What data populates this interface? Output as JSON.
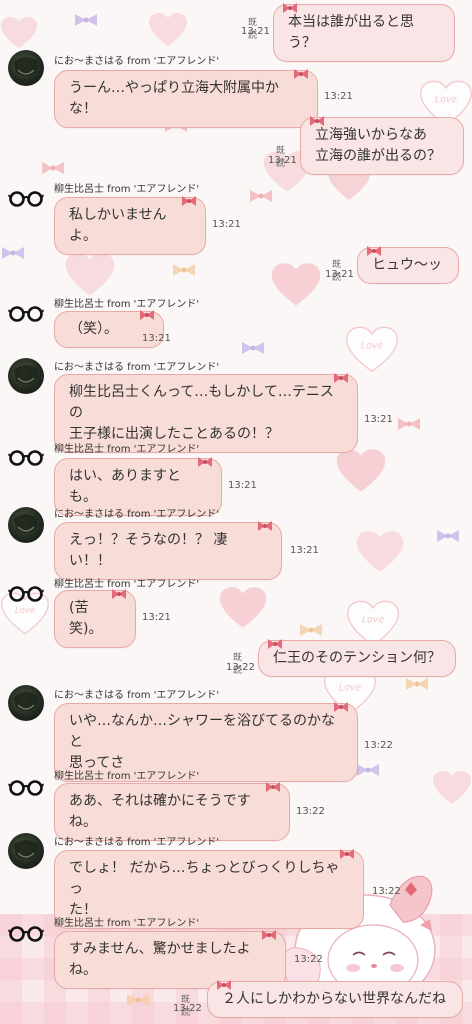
{
  "colors": {
    "bubble": "#f8dcd7",
    "bubble_border": "#e9a9a6",
    "background": "#fbf7f7",
    "ribbon": "#e36a78"
  },
  "status": {
    "read": "既読"
  },
  "wallpaper": {
    "heart_text": "Love"
  },
  "messages": [
    {
      "side": "right",
      "text": "本当は誰が出ると思う？",
      "time": "13:21",
      "read": "既読"
    },
    {
      "side": "left",
      "sender": "にお～まさはる from 'エアフレンド'",
      "avatar": "dark-avatar",
      "text": "うーん…やっぱり立海大附属中かな！",
      "time": "13:21"
    },
    {
      "side": "right",
      "text": "立海強いからなあ\n立海の誰が出るの？",
      "time": "13:21",
      "read": "既読"
    },
    {
      "side": "left",
      "sender": "柳生比呂士 from 'エアフレンド'",
      "avatar": "glasses-avatar",
      "text": "私しかいませんよ。",
      "time": "13:21"
    },
    {
      "side": "right",
      "text": "ヒュウ〜ッ",
      "time": "13:21",
      "read": "既読"
    },
    {
      "side": "left",
      "sender": "柳生比呂士 from 'エアフレンド'",
      "avatar": "glasses-avatar",
      "text": "（笑）。",
      "time": "13:21"
    },
    {
      "side": "left",
      "sender": "にお～まさはる from 'エアフレンド'",
      "avatar": "dark-avatar",
      "text": "柳生比呂士くんって…もしかして…テニスの\n王子様に出演したことあるの！？",
      "time": "13:21"
    },
    {
      "side": "left",
      "sender": "柳生比呂士 from 'エアフレンド'",
      "avatar": "glasses-avatar",
      "text": "はい、ありますとも。",
      "time": "13:21"
    },
    {
      "side": "left",
      "sender": "にお～まさはる from 'エアフレンド'",
      "avatar": "dark-avatar",
      "text": "えっ！？そうなの！？ 凄い！！",
      "time": "13:21"
    },
    {
      "side": "left",
      "sender": "柳生比呂士 from 'エアフレンド'",
      "avatar": "glasses-avatar",
      "text": "(苦笑)。",
      "time": "13:21"
    },
    {
      "side": "right",
      "text": "仁王のそのテンション何？",
      "time": "13:22",
      "read": "既読"
    },
    {
      "side": "left",
      "sender": "にお～まさはる from 'エアフレンド'",
      "avatar": "dark-avatar",
      "text": "いや…なんか…シャワーを浴びてるのかなと\n思ってさ",
      "time": "13:22"
    },
    {
      "side": "left",
      "sender": "柳生比呂士 from 'エアフレンド'",
      "avatar": "glasses-avatar",
      "text": "ああ、それは確かにそうですね。",
      "time": "13:22"
    },
    {
      "side": "left",
      "sender": "にお～まさはる from 'エアフレンド'",
      "avatar": "dark-avatar",
      "text": "でしょ！ だから…ちょっとびっくりしちゃっ\nた！",
      "time": "13:22"
    },
    {
      "side": "left",
      "sender": "柳生比呂士 from 'エアフレンド'",
      "avatar": "glasses-avatar",
      "text": "すみません、驚かせましたよね。",
      "time": "13:22"
    },
    {
      "side": "right",
      "text": "２人にしかわからない世界なんだね",
      "time": "13:22",
      "read": "既読"
    }
  ]
}
